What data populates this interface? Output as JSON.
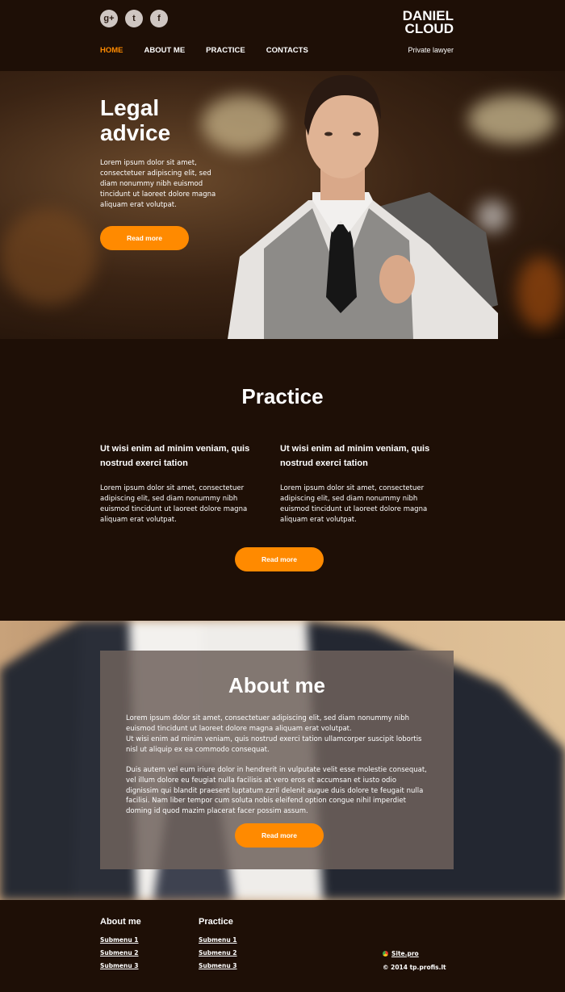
{
  "header": {
    "social": [
      {
        "name": "google-plus-icon",
        "glyph": "g+"
      },
      {
        "name": "twitter-icon",
        "glyph": "t"
      },
      {
        "name": "facebook-icon",
        "glyph": "f"
      }
    ],
    "brand_line1": "DANIEL",
    "brand_line2": "CLOUD",
    "tagline": "Private lawyer",
    "nav": [
      {
        "label": "HOME",
        "active": true
      },
      {
        "label": "ABOUT ME",
        "active": false
      },
      {
        "label": "PRACTICE",
        "active": false
      },
      {
        "label": "CONTACTS",
        "active": false
      }
    ]
  },
  "hero": {
    "title_line1": "Legal",
    "title_line2": "advice",
    "text": "Lorem ipsum dolor sit amet, consectetuer adipiscing elit, sed diam nonummy nibh euismod tincidunt ut laoreet dolore magna aliquam erat volutpat.",
    "button": "Read more"
  },
  "practice": {
    "title": "Practice",
    "columns": [
      {
        "heading": "Ut wisi enim ad minim veniam, quis nostrud exerci tation",
        "text": "Lorem ipsum dolor sit amet, consectetuer adipiscing elit, sed diam nonummy nibh euismod tincidunt ut laoreet dolore magna aliquam erat volutpat."
      },
      {
        "heading": "Ut wisi enim ad minim veniam, quis nostrud exerci tation",
        "text": "Lorem ipsum dolor sit amet, consectetuer adipiscing elit, sed diam nonummy nibh euismod tincidunt ut laoreet dolore magna aliquam erat volutpat."
      }
    ],
    "button": "Read more"
  },
  "about": {
    "title": "About me",
    "para1": "Lorem ipsum dolor sit amet, consectetuer adipiscing elit, sed diam nonummy nibh euismod tincidunt ut laoreet dolore magna aliquam erat volutpat.",
    "para2": "Ut wisi enim ad minim veniam, quis nostrud exerci tation ullamcorper suscipit lobortis nisl ut aliquip ex ea commodo consequat.",
    "para3": "Duis autem vel eum iriure dolor in hendrerit in vulputate velit esse molestie consequat, vel illum dolore eu feugiat nulla facilisis at vero eros et accumsan et iusto odio dignissim qui blandit praesent luptatum zzril delenit augue duis dolore te feugait nulla facilisi. Nam liber tempor cum soluta nobis eleifend option congue nihil imperdiet doming id quod mazim placerat facer possim assum.",
    "button": "Read more"
  },
  "footer": {
    "col1": {
      "title": "About me",
      "links": [
        "Submenu 1",
        "Submenu 2",
        "Submenu 3"
      ]
    },
    "col2": {
      "title": "Practice",
      "links": [
        "Submenu 1",
        "Submenu 2",
        "Submenu 3"
      ]
    },
    "site_link": "Site.pro",
    "copyright": "© 2014 tp.profis.lt"
  },
  "colors": {
    "accent": "#ff8a00",
    "background": "#1e0f06"
  }
}
